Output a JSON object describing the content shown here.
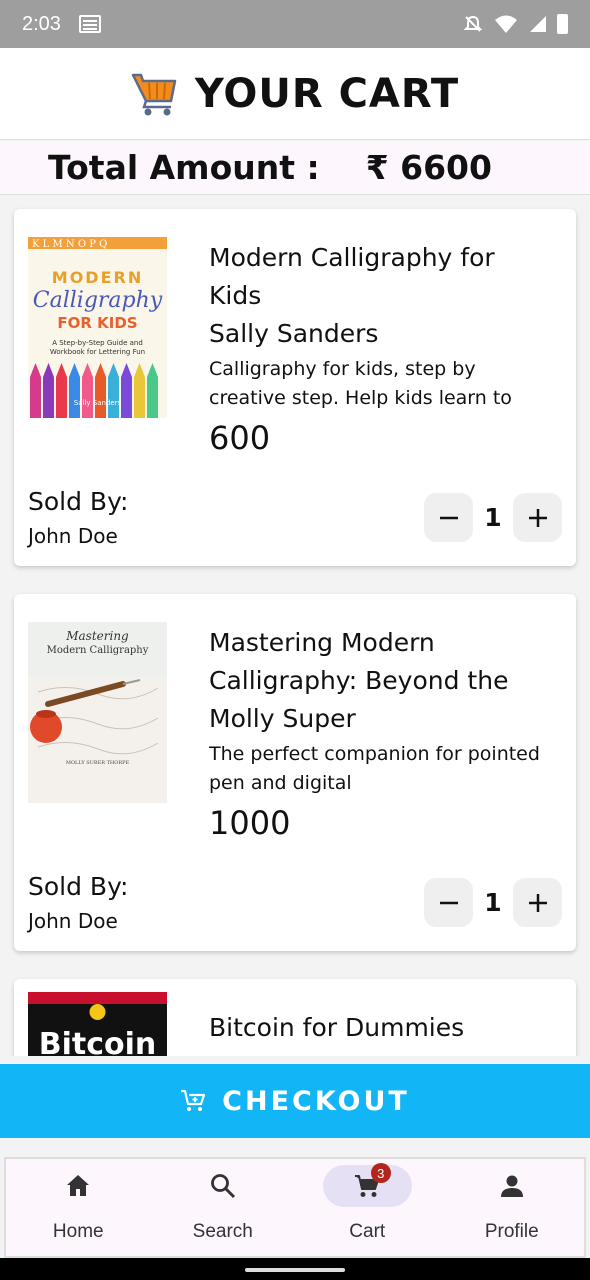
{
  "status_bar": {
    "time": "2:03"
  },
  "header": {
    "title": "YOUR CART",
    "icon": "shopping-cart-icon"
  },
  "total": {
    "label": "Total Amount :",
    "value": "₹ 6600"
  },
  "cart_items": [
    {
      "title": "Modern Calligraphy for Kids",
      "author": "Sally Sanders",
      "description": "Calligraphy for kids, step by creative step. Help kids learn to",
      "price": "600",
      "sold_by_label": "Sold By:",
      "seller": "John Doe",
      "quantity": "1",
      "cover": {
        "top_text": "K L M N O P Q",
        "line1": "MODERN",
        "line2": "Calligraphy",
        "line3": "FOR KIDS",
        "subtitle1": "A Step-by-Step Guide and",
        "subtitle2": "Workbook for Lettering Fun",
        "author": "Sally Sanders"
      }
    },
    {
      "title": "Mastering Modern Calligraphy: Beyond the",
      "author": "Molly Super",
      "description": "The perfect companion for pointed pen and digital",
      "price": "1000",
      "sold_by_label": "Sold By:",
      "seller": "John Doe",
      "quantity": "1",
      "cover": {
        "line1": "Mastering",
        "line2": "Modern Calligraphy",
        "author": "MOLLY SUBER THORPE"
      }
    },
    {
      "title": "Bitcoin for Dummies",
      "cover": {
        "line1": "Bitcoin"
      }
    }
  ],
  "checkout": {
    "label": "CHECKOUT",
    "icon": "cart-plus-icon"
  },
  "bottom_nav": [
    {
      "label": "Home",
      "icon": "home-icon"
    },
    {
      "label": "Search",
      "icon": "search-icon"
    },
    {
      "label": "Cart",
      "icon": "cart-icon",
      "badge": "3",
      "active": true
    },
    {
      "label": "Profile",
      "icon": "person-icon"
    }
  ],
  "colors": {
    "accent": "#12b5f5",
    "status_bar": "#9e9e9e",
    "active_nav": "#e6e0f5",
    "badge": "#b3261e"
  }
}
